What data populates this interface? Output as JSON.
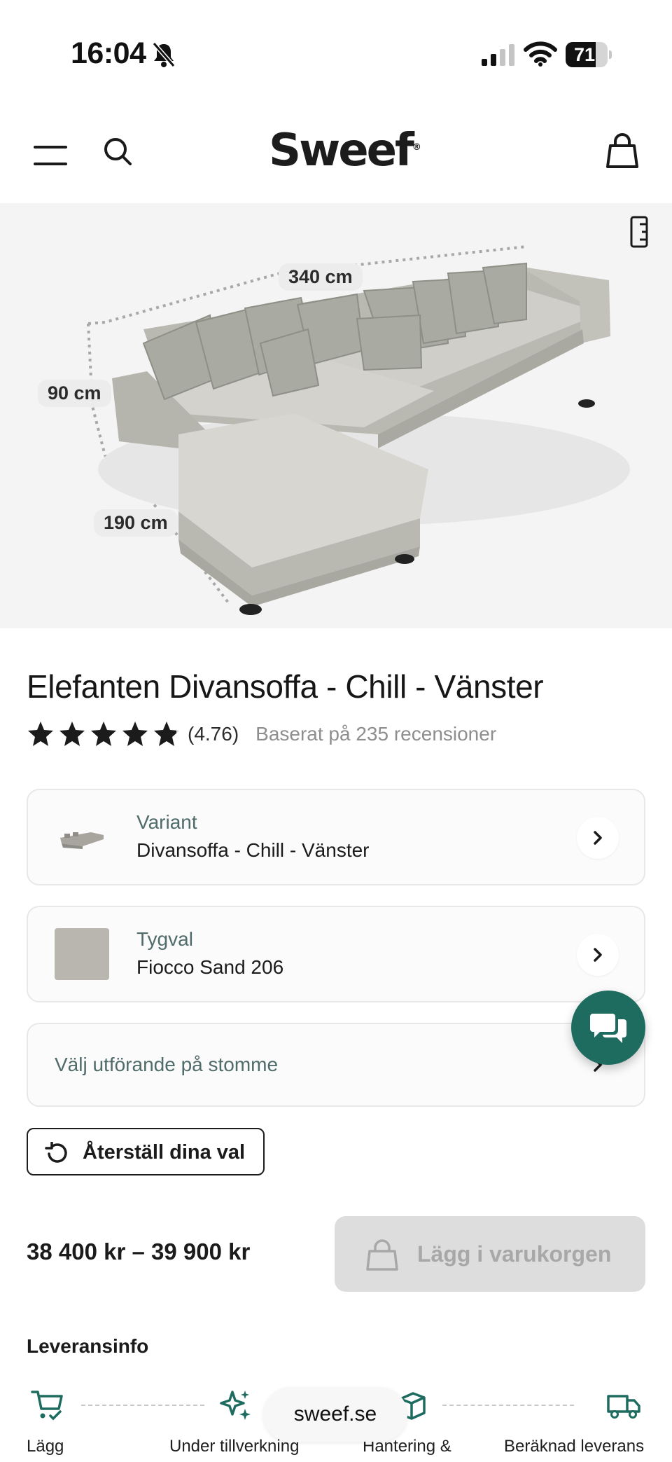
{
  "status_bar": {
    "time": "16:04",
    "battery": "71",
    "battery_level_percent": 71
  },
  "header": {
    "logo": "Sweef",
    "logo_mark": "®"
  },
  "hero": {
    "dimensions": {
      "width": "340 cm",
      "height": "90 cm",
      "depth": "190 cm"
    }
  },
  "product": {
    "title": "Elefanten Divansoffa - Chill - Vänster",
    "rating_value": "(4.76)",
    "rating_stars": 4.76,
    "reviews_text": "Baserat på 235 recensioner"
  },
  "options": {
    "variant": {
      "label": "Variant",
      "value": "Divansoffa - Chill - Vänster"
    },
    "fabric": {
      "label": "Tygval",
      "value": "Fiocco Sand 206",
      "swatch_color": "#b9b6af"
    },
    "frame": {
      "label": "Välj utförande på stomme"
    }
  },
  "actions": {
    "reset_label": "Återställ dina val",
    "add_to_cart_label": "Lägg i varukorgen"
  },
  "price": "38 400 kr – 39 900 kr",
  "delivery": {
    "title": "Leveransinfo",
    "steps": [
      {
        "icon": "cart-check-icon",
        "label": "Lägg"
      },
      {
        "icon": "sparkles-icon",
        "label": "Under tillverkning"
      },
      {
        "icon": "box-icon",
        "label": "Hantering &"
      },
      {
        "icon": "truck-icon",
        "label": "Beräknad leverans"
      }
    ]
  },
  "browser": {
    "url": "sweef.se"
  },
  "colors": {
    "accent_green": "#1e6b5f",
    "muted_label": "#4f6b6a",
    "hero_bg": "#f4f4f4",
    "disabled_button": "#dddddd"
  }
}
